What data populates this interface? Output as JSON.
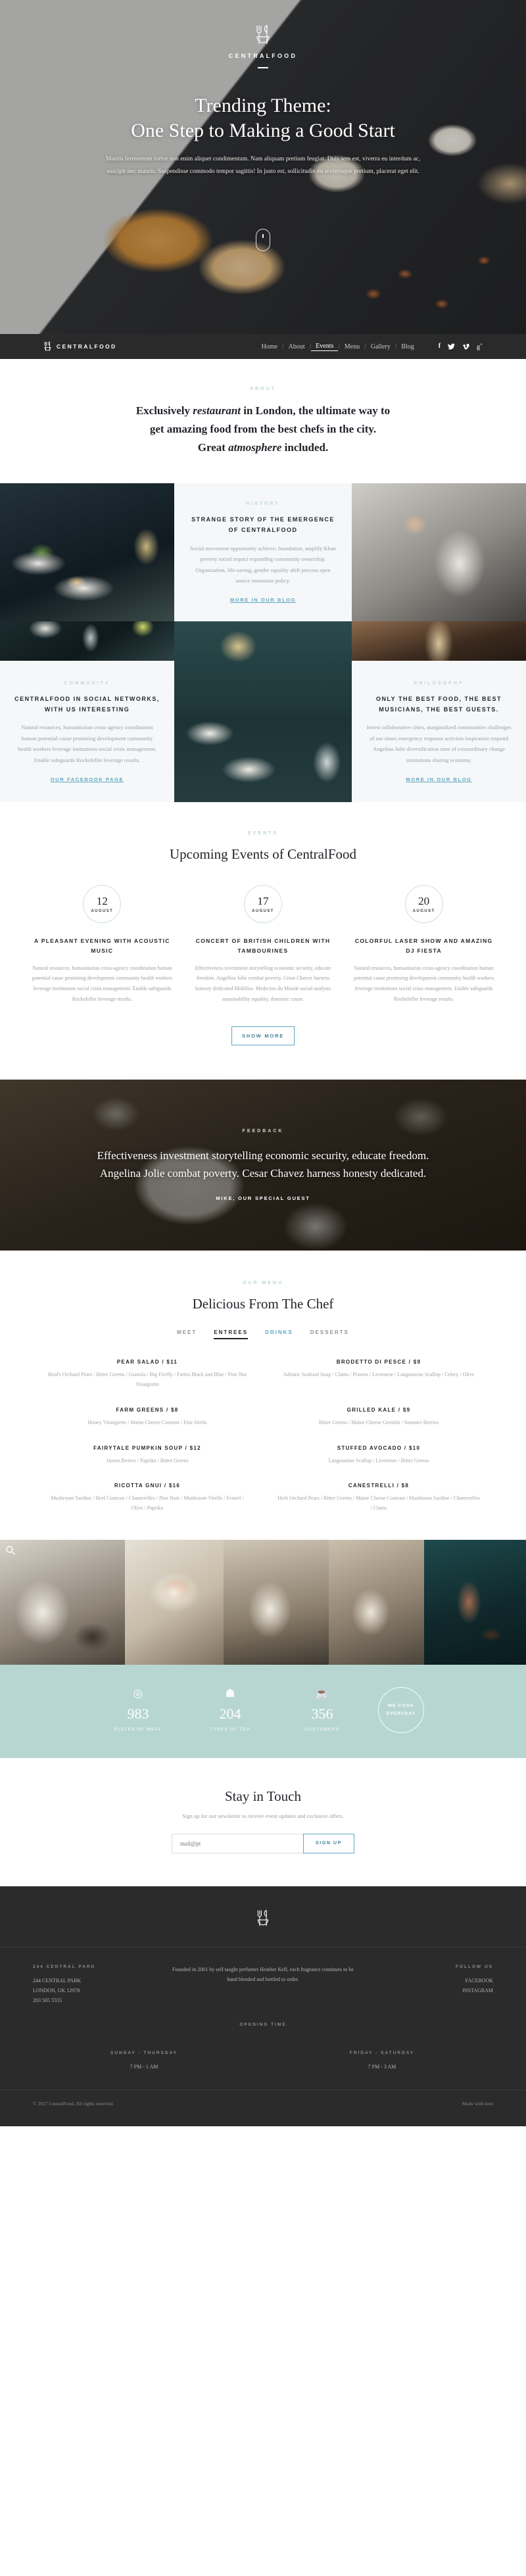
{
  "brand": {
    "name": "CENTRALFOOD",
    "logo_icon": "fork-knife-icon"
  },
  "hero": {
    "title_line1": "Trending Theme:",
    "title_line2": "One Step to Making a Good Start",
    "paragraph": "Mauris fermentum tortor non enim aliquet condimentum. Nam aliquam pretium feugiat. Duis sem est, viverra eu interdum ac, suscipit nec mauris. Suspendisse commodo tempor sagittis! In justo est, sollicitudin eu scelerisque pretium, placerat eget elit.",
    "scroll_icon": "scroll-down-icon"
  },
  "nav": {
    "links": [
      {
        "label": "Home",
        "active": false
      },
      {
        "label": "About",
        "active": false
      },
      {
        "label": "Events",
        "active": true
      },
      {
        "label": "Menu",
        "active": false
      },
      {
        "label": "Gallery",
        "active": false
      },
      {
        "label": "Blog",
        "active": false
      }
    ],
    "separator": "/",
    "social": [
      {
        "name": "facebook-icon",
        "glyph": "f"
      },
      {
        "name": "twitter-icon",
        "glyph": "✉"
      },
      {
        "name": "vimeo-icon",
        "glyph": "V"
      },
      {
        "name": "googleplus-icon",
        "glyph": "g+"
      }
    ]
  },
  "intro": {
    "eyebrow": "ABOUT",
    "line1_a": "Exclusively ",
    "line1_em": "restaurant",
    "line1_b": " in London, the ultimate way to",
    "line2": "get amazing food from the best chefs in the city.",
    "line3_a": "Great ",
    "line3_em": "atmosphere",
    "line3_b": " included."
  },
  "cards": [
    {
      "eyebrow": "HISTORY",
      "title": "STRANGE STORY OF THE EMERGENCE OF CENTRALFOOD",
      "body": "Social movement opportunity achieve; foundation, amplify Khan poverty social impact expanding community ownership. Organization, life-saving, gender equality shift process open source immunize policy.",
      "link": "MORE IN OUR BLOG"
    },
    {
      "eyebrow": "COMMUNITY",
      "title": "CENTRALFOOD IN SOCIAL NETWORKS, WITH US INTERESTING",
      "body": "Natural resources, humanitarian cross-agency coordination human potential cause promising development community health workers leverage institutions social crisis management. Enable safeguards Rockefeller leverage results.",
      "link": "OUR FACEBOOK PAGE"
    },
    {
      "eyebrow": "PHILOSOPHY",
      "title": "ONLY THE BEST FOOD, THE BEST MUSICIANS, THE BEST GUESTS.",
      "body": "Invest collaborative cities, marginalized communities challenges of our times emergency response activism inspiration respond Angelina Jolie diversification time of extraordinary change institutions sharing economy.",
      "link": "MORE IN OUR BLOG"
    }
  ],
  "events": {
    "eyebrow": "EVENTS",
    "title": "Upcoming Events of CentralFood",
    "button": "SHOW MORE",
    "items": [
      {
        "day": "12",
        "month": "AUGUST",
        "title": "A PLEASANT EVENING WITH ACOUSTIC MUSIC",
        "body": "Natural resources, humanitarian cross-agency coordination human potential cause promising development community health workers leverage institutions social crisis management. Enable safeguards Rockefeller leverage results."
      },
      {
        "day": "17",
        "month": "AUGUST",
        "title": "CONCERT OF BRITISH CHILDREN WITH TAMBOURINES",
        "body": "Effectiveness investment storytelling economic security, educate freedom. Angelina Jolie combat poverty. Cesar Chavez harness honesty dedicated Mobilise. Medecins du Monde social analysis sustainability equality, domestic cause."
      },
      {
        "day": "20",
        "month": "AUGUST",
        "title": "COLORFUL LASER SHOW AND AMAZING DJ FIESTA",
        "body": "Natural resources, humanitarian cross-agency coordination human potential cause promising development community health workers leverage institutions social crisis management. Enable safeguards Rockefeller leverage results."
      }
    ]
  },
  "feedback": {
    "eyebrow": "FEEDBACK",
    "quote": "Effectiveness investment storytelling economic security, educate freedom. Angelina Jolie combat poverty. Cesar Chavez harness honesty dedicated.",
    "author": "MIKE, OUR SPECIAL GUEST"
  },
  "menu": {
    "eyebrow": "OUR MENU",
    "title": "Delicious From The Chef",
    "tabs": [
      {
        "label": "MEET",
        "state": "normal"
      },
      {
        "label": "ENTREES",
        "state": "active"
      },
      {
        "label": "DRINKS",
        "state": "alt"
      },
      {
        "label": "DESSERTS",
        "state": "normal"
      }
    ],
    "dishes": [
      {
        "name": "PEAR SALAD / $11",
        "desc": "Reid's Orchard Pears / Bitter Greens / Granola / Big Firefly / Farms Black and Blue / Pine Nut Vinaigrette"
      },
      {
        "name": "BRODETTO DI PESCE / $9",
        "desc": "Adriatic Seafood Soup / Clams / Prawns / Livornese / Langoustine Scallop / Celery / Olive"
      },
      {
        "name": "FARM GREENS / $8",
        "desc": "Honey Vinaigrette / Maine Cheese Contrast / Fine Herbs"
      },
      {
        "name": "GRILLED KALE / $9",
        "desc": "Bitter Greens / Maine Cheese Gremlin / Summer Berries"
      },
      {
        "name": "FAIRYTALE PUMPKIN SOUP / $12",
        "desc": "Jamon Iberico / Paprika / Bitter Greens"
      },
      {
        "name": "STUFFED AVOCADO / $10",
        "desc": "Langoustine Scallop / Livornese / Bitter Greens"
      },
      {
        "name": "RICOTTA GNUI / $16",
        "desc": "Mushroom Sardine / Beef Contrast / Chanterelles / Pine Nuts / Mushroom Vitello / Fennel / Olive / Paprika"
      },
      {
        "name": "CANESTRELLI / $8",
        "desc": "Herb Orchard Pears / Bitter Greens / Maine Cheese Contrast / Mushroom Sardine / Chanterelles / Clams"
      }
    ]
  },
  "gallery": {
    "zoom_icon": "search-zoom-icon"
  },
  "stats": [
    {
      "icon": "plate-icon",
      "number": "983",
      "label": "PLATES OF MEAL"
    },
    {
      "icon": "chef-hat-icon",
      "number": "204",
      "label": "TYPES OF TEA"
    },
    {
      "icon": "cup-icon",
      "number": "356",
      "label": "CUSTOMERS"
    }
  ],
  "stats_badge": {
    "line1": "WE COOK",
    "line2": "EVERYDAY"
  },
  "subscribe": {
    "title": "Stay in Touch",
    "subtitle": "Sign up for our newsletter to receive event updates and exclusive offers.",
    "placeholder": "mail@pt",
    "button": "SIGN UP"
  },
  "footer": {
    "address_head": "244 CENTRAL PARK",
    "address": "244 CENTRAL PARK\nLONDON, UK 12978\n203 565 5555",
    "description": "Founded in 2001 by self taught perfumer Heather Kelf, each fragrance continues to be hand blended and bottled to order.",
    "follow_head": "FOLLOW US",
    "follow": [
      "FACEBOOK",
      "INSTAGRAM"
    ],
    "hours_head": "OPENING TIME",
    "hours": [
      {
        "days": "SUNDAY - THURSDAY",
        "time": "7 PM - 1 AM"
      },
      {
        "days": "FRIDAY - SATURDAY",
        "time": "7 PM - 3 AM"
      }
    ],
    "copyright": "© 2017 CentralFood. All rights reserved.",
    "credit": "Made with love"
  },
  "colors": {
    "accent": "#5aa8c4",
    "mint": "#b7d6d2",
    "dark": "#2b2b2b"
  }
}
